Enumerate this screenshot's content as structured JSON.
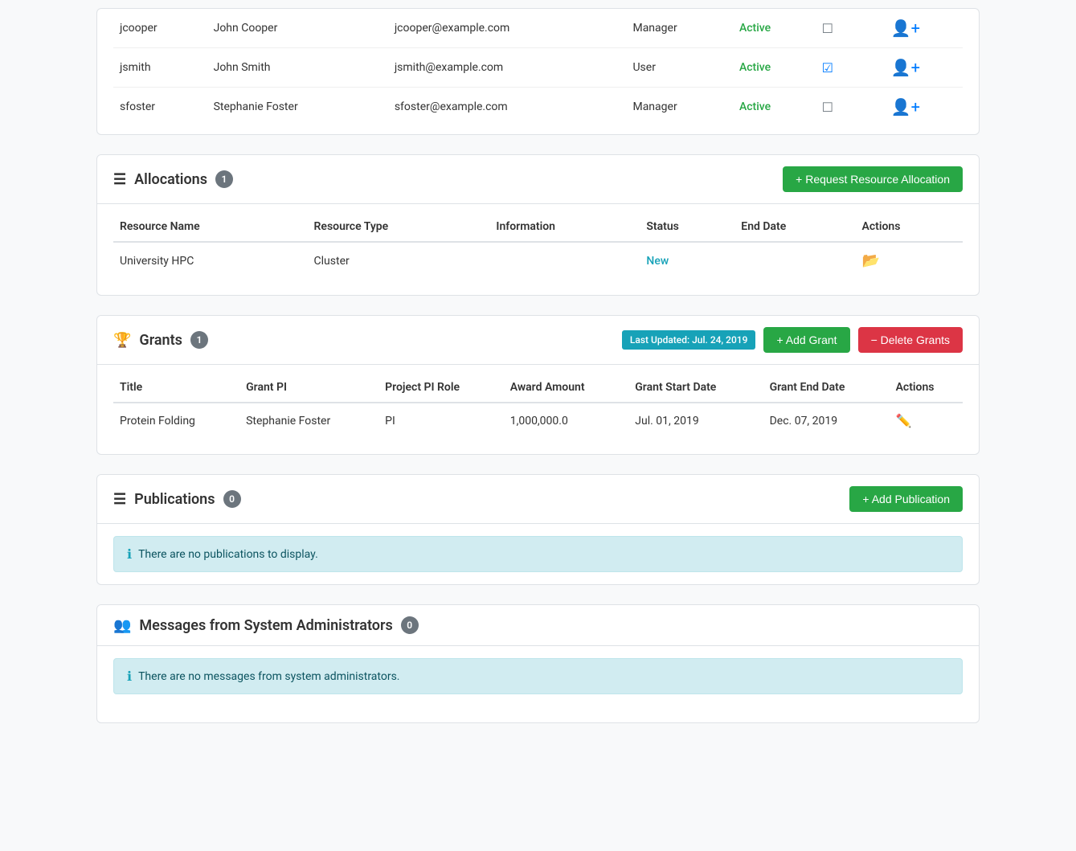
{
  "users": {
    "rows": [
      {
        "username": "jcooper",
        "full_name": "John Cooper",
        "email": "jcooper@example.com",
        "role": "Manager",
        "status": "Active",
        "checked": false
      },
      {
        "username": "jsmith",
        "full_name": "John Smith",
        "email": "jsmith@example.com",
        "role": "User",
        "status": "Active",
        "checked": true
      },
      {
        "username": "sfoster",
        "full_name": "Stephanie Foster",
        "email": "sfoster@example.com",
        "role": "Manager",
        "status": "Active",
        "checked": false
      }
    ]
  },
  "allocations": {
    "title": "Allocations",
    "badge": "1",
    "request_button": "+ Request Resource Allocation",
    "columns": [
      "Resource Name",
      "Resource Type",
      "Information",
      "Status",
      "End Date",
      "Actions"
    ],
    "rows": [
      {
        "resource_name": "University HPC",
        "resource_type": "Cluster",
        "information": "",
        "status": "New",
        "end_date": "",
        "has_folder": true
      }
    ]
  },
  "grants": {
    "title": "Grants",
    "badge": "1",
    "last_updated_label": "Last Updated: Jul. 24, 2019",
    "add_button": "+ Add Grant",
    "delete_button": "− Delete Grants",
    "columns": [
      "Title",
      "Grant PI",
      "Project PI Role",
      "Award Amount",
      "Grant Start Date",
      "Grant End Date",
      "Actions"
    ],
    "rows": [
      {
        "title": "Protein Folding",
        "grant_pi": "Stephanie Foster",
        "project_pi_role": "PI",
        "award_amount": "1,000,000.0",
        "grant_start_date": "Jul. 01, 2019",
        "grant_end_date": "Dec. 07, 2019"
      }
    ]
  },
  "publications": {
    "title": "Publications",
    "badge": "0",
    "add_button": "+ Add Publication",
    "empty_message": "There are no publications to display."
  },
  "messages": {
    "title": "Messages from System Administrators",
    "badge": "0",
    "empty_message": "There are no messages from system administrators."
  }
}
